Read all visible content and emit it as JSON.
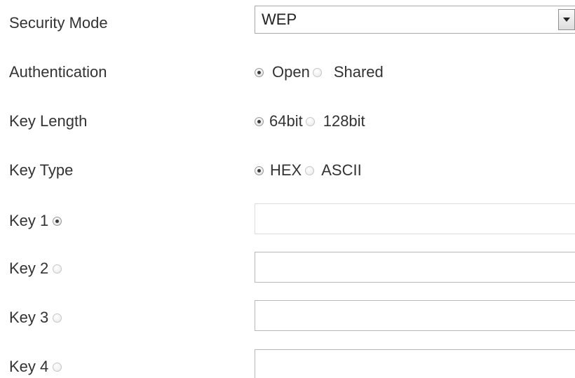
{
  "security_mode": {
    "label": "Security Mode",
    "selected": "WEP"
  },
  "authentication": {
    "label": "Authentication",
    "options": [
      {
        "label": "Open",
        "checked": true
      },
      {
        "label": "Shared",
        "checked": false
      }
    ]
  },
  "key_length": {
    "label": "Key Length",
    "options": [
      {
        "label": "64bit",
        "checked": true
      },
      {
        "label": "128bit",
        "checked": false
      }
    ]
  },
  "key_type": {
    "label": "Key Type",
    "options": [
      {
        "label": "HEX",
        "checked": true
      },
      {
        "label": "ASCII",
        "checked": false
      }
    ]
  },
  "keys": [
    {
      "label": "Key 1",
      "selected": true,
      "value": ""
    },
    {
      "label": "Key 2",
      "selected": false,
      "value": ""
    },
    {
      "label": "Key 3",
      "selected": false,
      "value": ""
    },
    {
      "label": "Key 4",
      "selected": false,
      "value": ""
    }
  ]
}
